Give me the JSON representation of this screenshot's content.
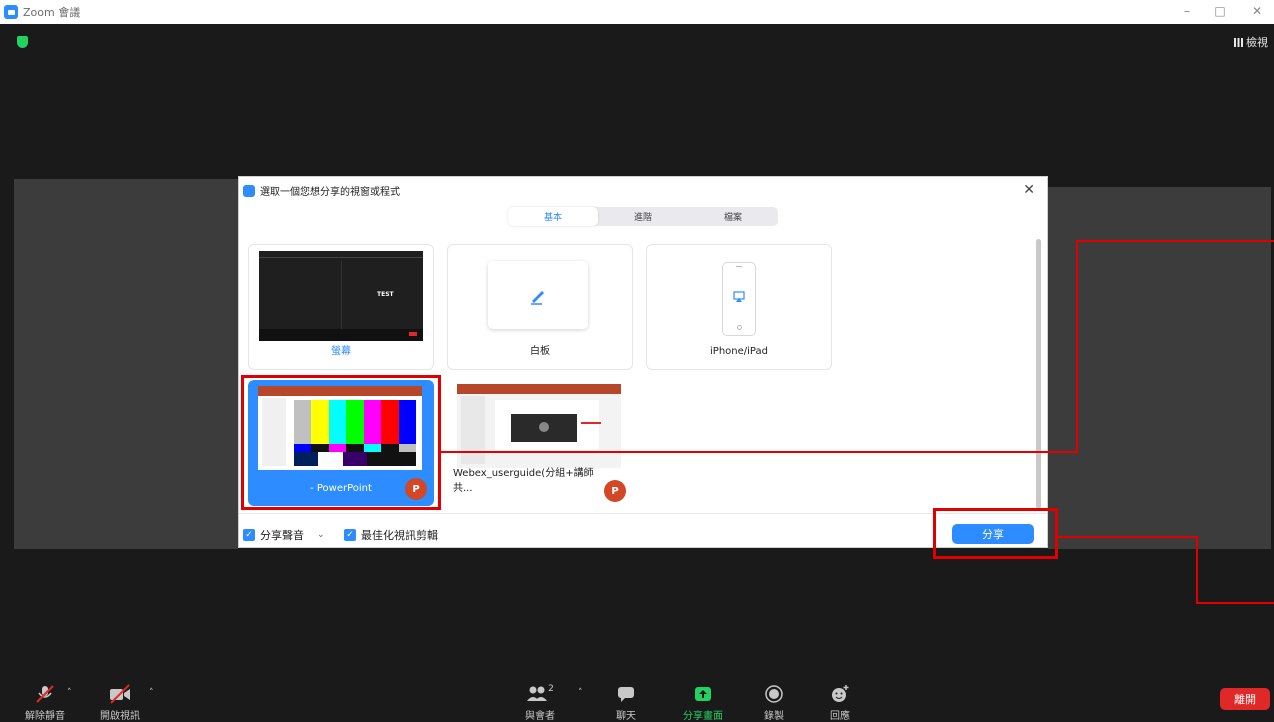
{
  "window": {
    "title": "Zoom 會議"
  },
  "meeting": {
    "view_label": "檢視"
  },
  "dialog": {
    "title": "選取一個您想分享的視窗或程式",
    "tabs": [
      {
        "label": "基本",
        "active": true
      },
      {
        "label": "進階",
        "active": false
      },
      {
        "label": "檔案",
        "active": false
      }
    ],
    "options": [
      {
        "label": "螢幕",
        "thumb_text": "TEST"
      },
      {
        "label": "白板"
      },
      {
        "label": "iPhone/iPad"
      }
    ],
    "apps": [
      {
        "label": "- PowerPoint",
        "badge": "P",
        "selected": true
      },
      {
        "label": "Webex_userguide(分組+講師共...",
        "badge": "P",
        "selected": false
      }
    ],
    "share_audio_label": "分享聲音",
    "optimize_label": "最佳化視訊剪輯",
    "share_button": "分享"
  },
  "toolbar": {
    "unmute": "解除靜音",
    "start_video": "開啟視訊",
    "participants": "與會者",
    "participants_count": "2",
    "chat": "聊天",
    "share_screen": "分享畫面",
    "record": "錄製",
    "reactions": "回應",
    "leave": "離開"
  },
  "colors": {
    "accent": "#2d8cff",
    "highlight": "#e00000",
    "leave": "#e02828",
    "share_green": "#23d160"
  }
}
